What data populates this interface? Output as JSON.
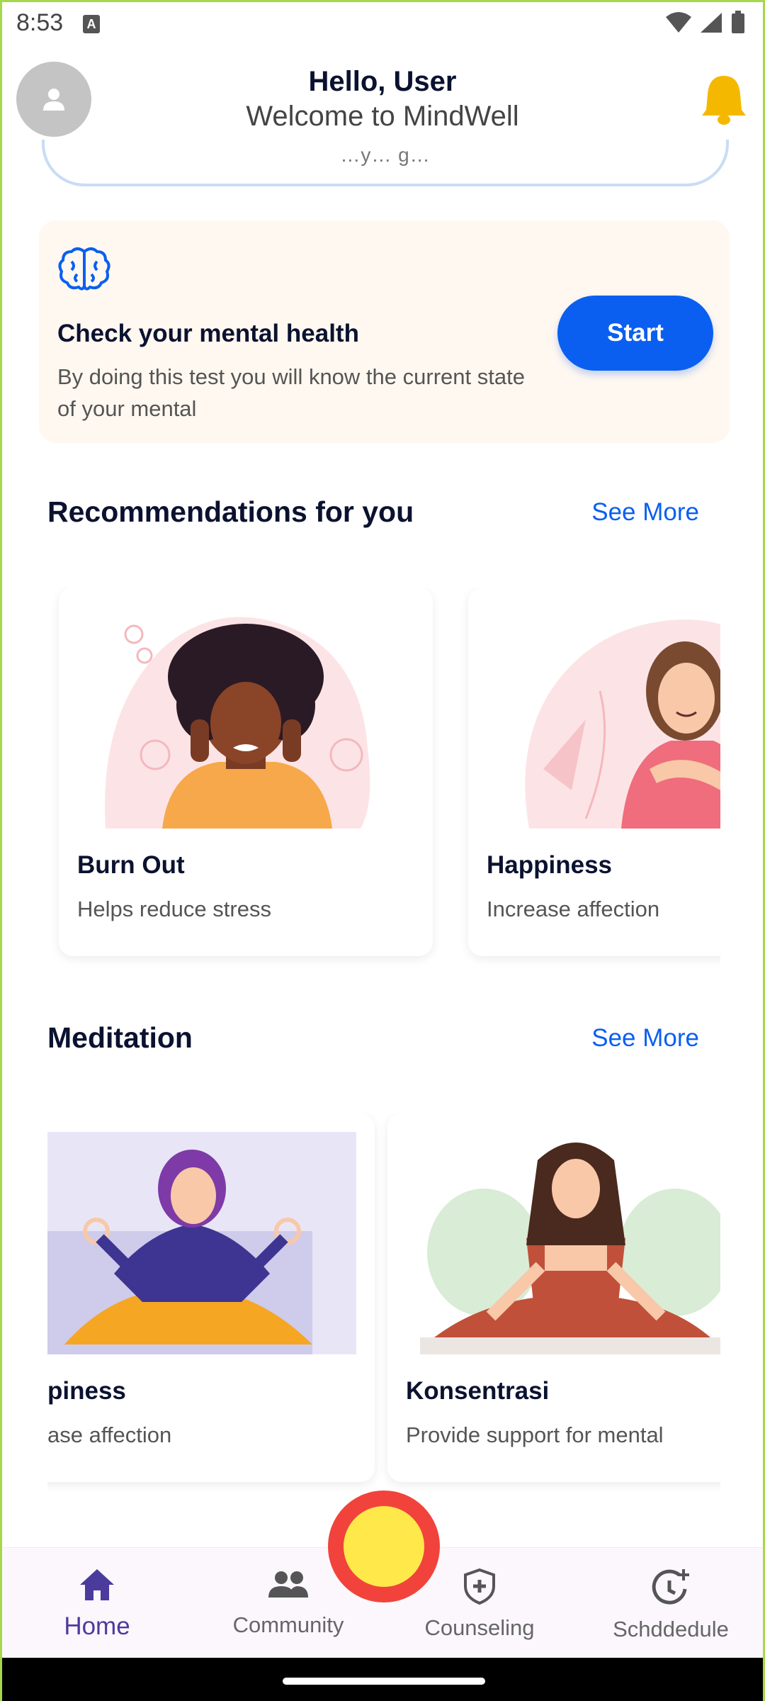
{
  "status": {
    "time": "8:53",
    "notification_glyph": "A"
  },
  "header": {
    "greeting": "Hello, User",
    "welcome": "Welcome to MindWell"
  },
  "search": {
    "partial_text": "…y… g…"
  },
  "mental_test": {
    "title": "Check your mental health",
    "description": "By doing this test you will know the current state of your mental",
    "start_label": "Start"
  },
  "recommendations": {
    "title": "Recommendations for you",
    "see_more": "See More",
    "items": [
      {
        "title": "Burn Out",
        "subtitle": "Helps reduce stress"
      },
      {
        "title": "Happiness",
        "subtitle": "Increase affection"
      }
    ]
  },
  "meditation": {
    "title": "Meditation",
    "see_more": "See More",
    "items": [
      {
        "title": "piness",
        "subtitle": "ase affection"
      },
      {
        "title": "Konsentrasi",
        "subtitle": "Provide support for mental"
      }
    ]
  },
  "nav": {
    "items": [
      {
        "label": "Home",
        "icon": "home-icon"
      },
      {
        "label": "Community",
        "icon": "people-icon"
      },
      {
        "label": "Counseling",
        "icon": "shield-plus-icon"
      },
      {
        "label": "Schddedule",
        "icon": "clock-plus-icon"
      }
    ]
  },
  "colors": {
    "accent": "#0b5ff0",
    "nav_active": "#4b3b9c",
    "bell": "#f5b800",
    "fab_ring": "#f1433b",
    "fab_fill": "#ffe84a"
  }
}
